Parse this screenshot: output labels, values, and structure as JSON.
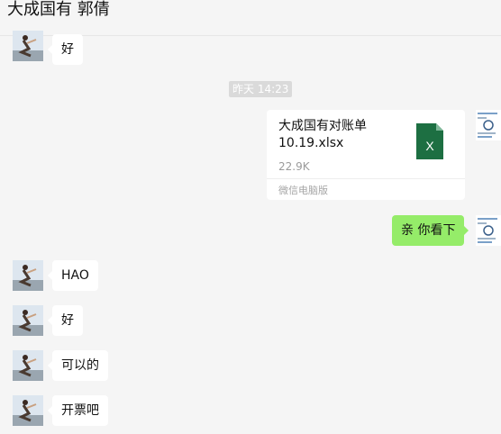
{
  "header": {
    "title": "大成国有 郭倩"
  },
  "messages": {
    "m1": "好",
    "timestamp": "昨天 14:23",
    "file": {
      "name": "大成国有对账单10.19.xlsx",
      "size": "22.9K",
      "source": "微信电脑版",
      "icon_letter": "X"
    },
    "m2": "亲 你看下",
    "m3": "HAO",
    "m4": "好",
    "m5": "可以的",
    "m6": "开票吧"
  },
  "colors": {
    "self_bubble": "#95ec69",
    "other_bubble": "#ffffff",
    "excel_green": "#1d6f42"
  }
}
